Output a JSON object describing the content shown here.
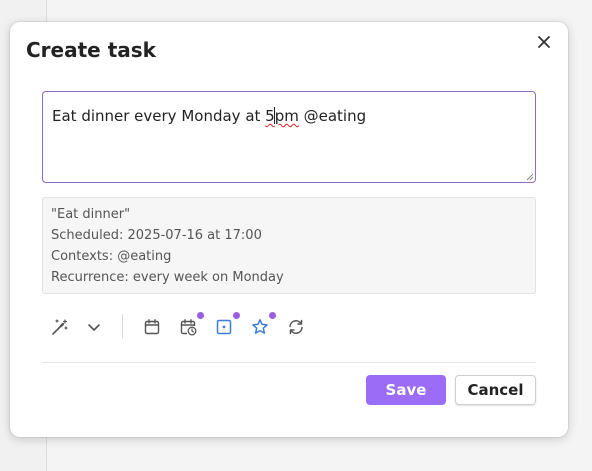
{
  "dialog": {
    "title": "Create task",
    "close_icon": "close-icon"
  },
  "task_input": {
    "value_before_caret": "Eat dinner every Monday at 5",
    "value_after_caret": "pm @eating",
    "spellcheck_word": "5pm"
  },
  "preview": {
    "lines": [
      "\"Eat dinner\"",
      "Scheduled: 2025-07-16 at 17:00",
      "Contexts: @eating",
      "Recurrence: every week on Monday"
    ]
  },
  "toolbar": {
    "icons": [
      {
        "name": "magic-wand-icon",
        "badge": false
      },
      {
        "name": "chevron-down-icon",
        "badge": false
      },
      {
        "name": "calendar-icon",
        "badge": false
      },
      {
        "name": "calendar-clock-icon",
        "badge": true
      },
      {
        "name": "context-square-icon",
        "badge": true
      },
      {
        "name": "star-icon",
        "badge": true
      },
      {
        "name": "repeat-icon",
        "badge": false
      }
    ],
    "accent_color": "#3b7ddd",
    "badge_color": "#9b5de5"
  },
  "buttons": {
    "save_label": "Save",
    "cancel_label": "Cancel",
    "save_color": "#9b6cf5"
  }
}
